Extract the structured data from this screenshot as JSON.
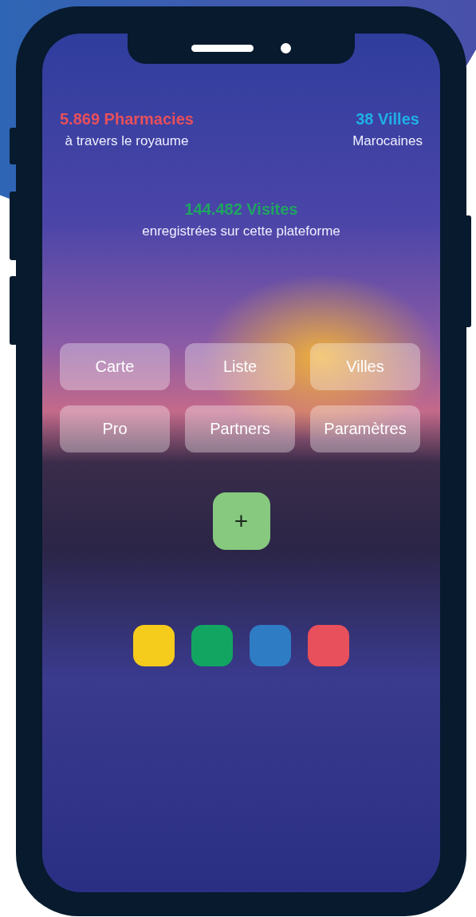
{
  "stats": [
    {
      "value": "5.869 Pharmacies",
      "caption": "à travers le royaume",
      "color": "#e8505b"
    },
    {
      "value": "38 Villes",
      "caption": "Marocaines",
      "color": "#1fb0e6"
    }
  ],
  "featured_stat": {
    "value": "144.482 Visites",
    "caption": "enregistrées sur cette plateforme",
    "color": "#1fa561"
  },
  "menu": [
    "Carte",
    "Liste",
    "Villes",
    "Pro",
    "Partners",
    "Paramètres"
  ],
  "add_button": "+",
  "swatches": [
    {
      "color": "#f5cb1c"
    },
    {
      "color": "#12a561"
    },
    {
      "color": "#2e7cc4"
    },
    {
      "color": "#e8505b"
    }
  ]
}
